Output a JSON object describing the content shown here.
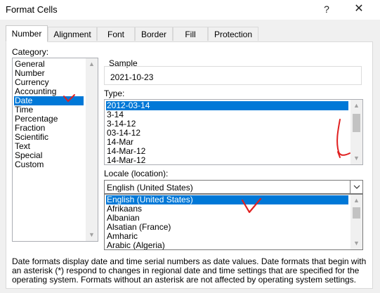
{
  "window": {
    "title": "Format Cells",
    "help_glyph": "?",
    "close_glyph": "✕"
  },
  "tabs": [
    {
      "label": "Number",
      "active": true
    },
    {
      "label": "Alignment"
    },
    {
      "label": "Font"
    },
    {
      "label": "Border"
    },
    {
      "label": "Fill"
    },
    {
      "label": "Protection"
    }
  ],
  "category": {
    "label": "Category:",
    "items": [
      "General",
      "Number",
      "Currency",
      "Accounting",
      "Date",
      "Time",
      "Percentage",
      "Fraction",
      "Scientific",
      "Text",
      "Special",
      "Custom"
    ],
    "selected": "Date"
  },
  "sample": {
    "label": "Sample",
    "value": "2021-10-23"
  },
  "type": {
    "label": "Type:",
    "items": [
      "2012-03-14",
      "3-14",
      "3-14-12",
      "03-14-12",
      "14-Mar",
      "14-Mar-12",
      "14-Mar-12"
    ],
    "selected": "2012-03-14"
  },
  "locale": {
    "label": "Locale (location):",
    "value": "English (United States)",
    "items": [
      "English (United States)",
      "Afrikaans",
      "Albanian",
      "Alsatian (France)",
      "Amharic",
      "Arabic (Algeria)"
    ],
    "selected": "English (United States)"
  },
  "description": "Date formats display date and time serial numbers as date values.  Date formats that begin with an asterisk (*) respond to changes in regional date and time settings that are specified for the operating system. Formats without an asterisk are not affected by operating system settings.",
  "colors": {
    "selection": "#0078d7",
    "annotation": "#e02020"
  },
  "icons": {
    "scroll_up": "▲",
    "scroll_down": "▼",
    "dropdown": "chevron-down-icon"
  }
}
